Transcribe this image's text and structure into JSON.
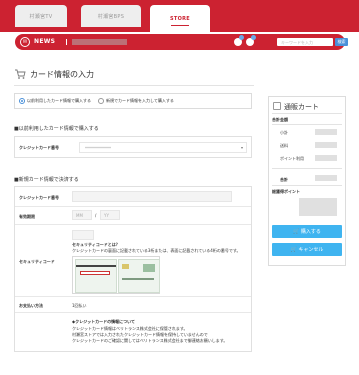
{
  "tabs": [
    {
      "label": "村瀬宮TV"
    },
    {
      "label": "村瀬宮BPS"
    },
    {
      "label": "STORE"
    }
  ],
  "newsbar": {
    "label": "NEWS",
    "search_placeholder": "キーワードを入力",
    "search_button": "検索"
  },
  "page": {
    "title": "カード情報の入力"
  },
  "payment_options": [
    {
      "label": "以前利用したカード情報で購入する",
      "selected": true
    },
    {
      "label": "新規でカード情報を入力して購入する",
      "selected": false
    }
  ],
  "section_saved": {
    "title": "■以前利用したカード情報で購入する",
    "card_number_label": "クレジットカード番号",
    "card_number_value": "*************"
  },
  "section_new": {
    "title": "■新規カード情報で決済する",
    "card_number_label": "クレジットカード番号",
    "expiry_label": "有効期限",
    "expiry_month_placeholder": "MM",
    "expiry_separator": "/",
    "expiry_year_placeholder": "YY",
    "security_label": "セキュリティコード",
    "security_heading": "セキュリティコードとは？",
    "security_desc": "クレジットカードの裏面に記載されている3桁または、表面に記載されている4桁の番号です。",
    "payment_count_label": "お支払い方法",
    "payment_count_value": "1回払い",
    "notice_heading": "◆クレジットカードの情報について",
    "notice_lines": [
      "クレジットカード情報はベリトランス株式会社に保管されます。",
      "村瀬宮ストアでは入力されたクレジットカード情報を保持していませんので",
      "クレジットカードのご確認に関してはベリトランス株式会社まで御連絡お願いします。"
    ]
  },
  "cart": {
    "title": "通販カート",
    "total_section": "合計金額",
    "items": [
      {
        "label": "小計"
      },
      {
        "label": "送料"
      },
      {
        "label": "ポイント利用"
      }
    ],
    "total_label": "合計",
    "points_section": "総獲得ポイント",
    "buy_button": "購入する",
    "cancel_button": "キャンセル"
  },
  "colors": {
    "brand": "#cc2231",
    "accent": "#3fb4f0"
  }
}
